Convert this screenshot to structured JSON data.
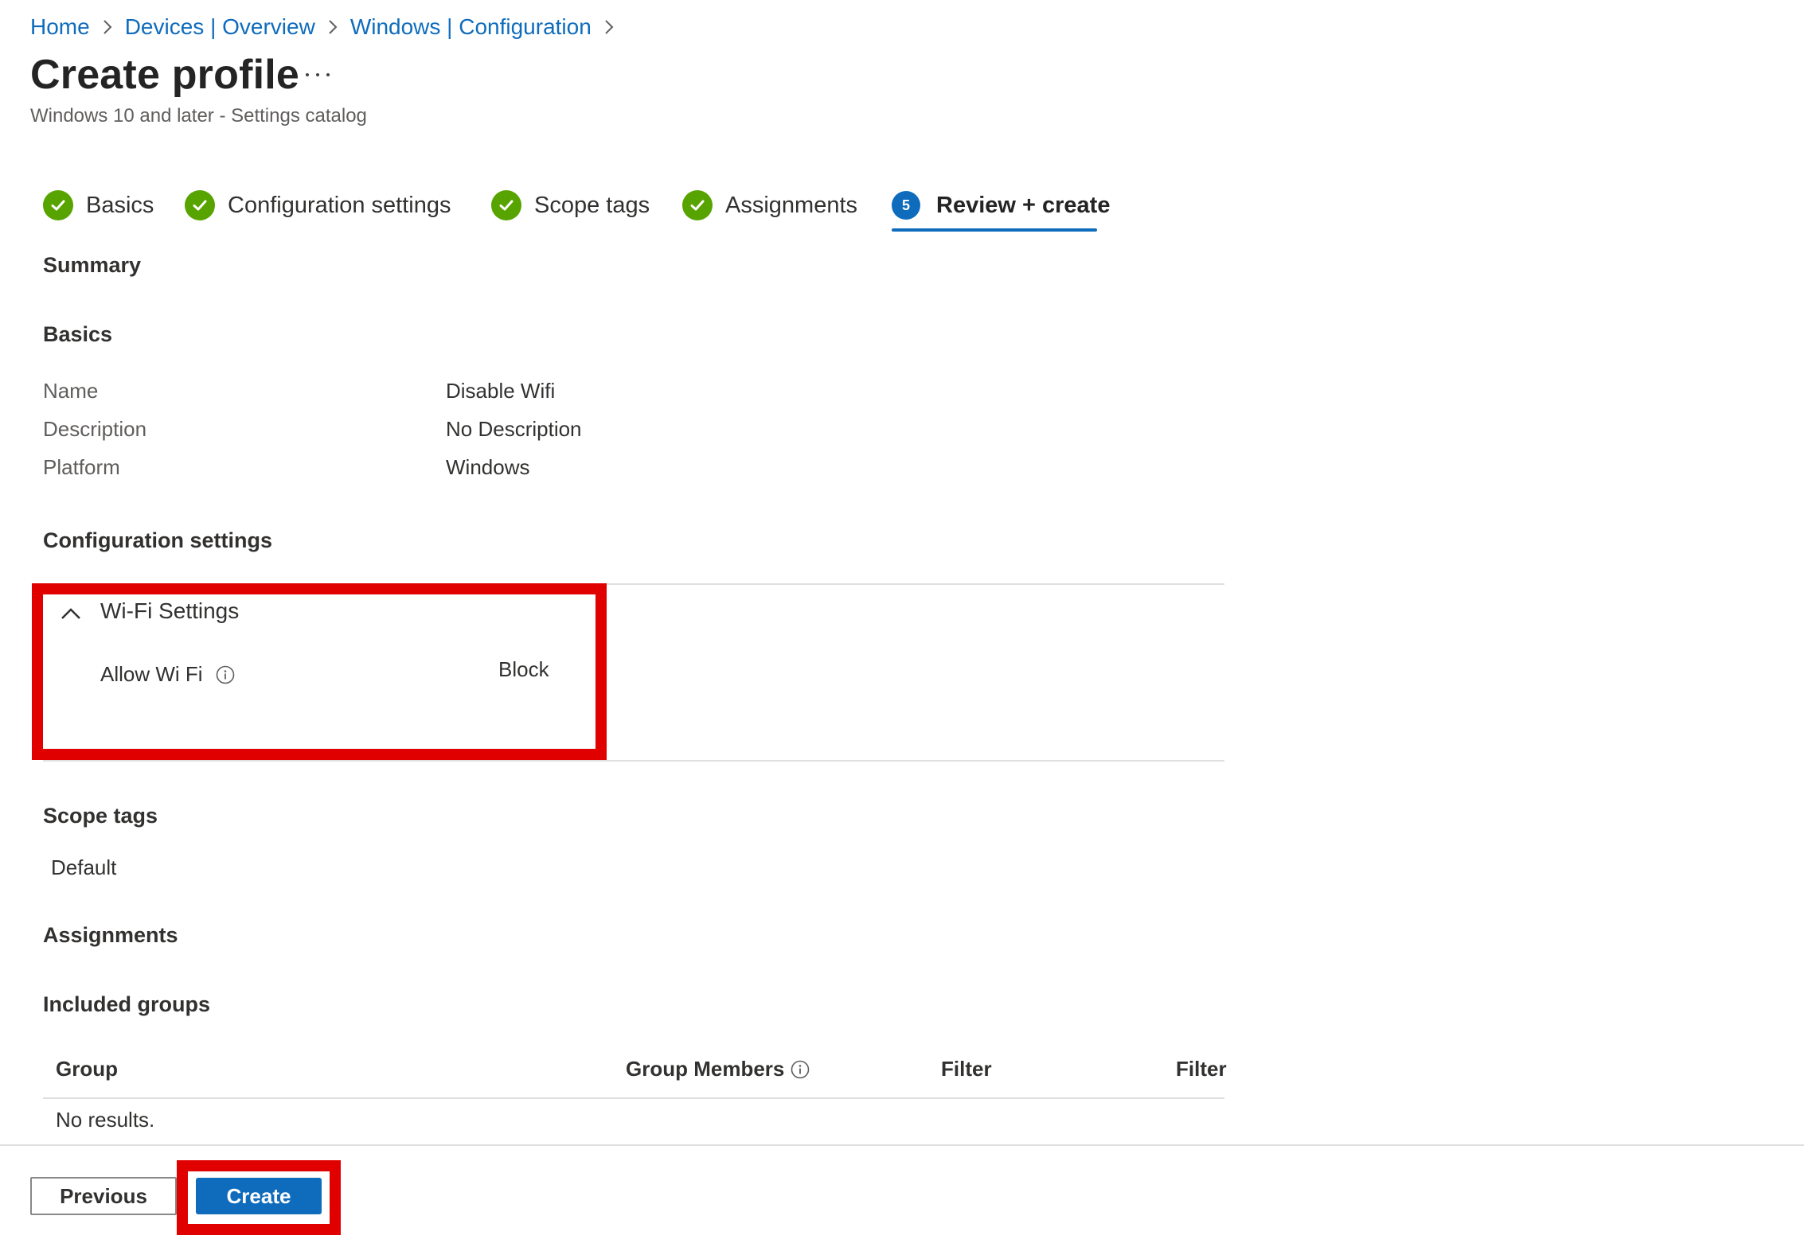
{
  "breadcrumb": {
    "items": [
      "Home",
      "Devices | Overview",
      "Windows | Configuration"
    ]
  },
  "header": {
    "title": "Create profile",
    "more_icon": "more-horizontal-icon",
    "subtitle": "Windows 10 and later - Settings catalog"
  },
  "steps": [
    {
      "label": "Basics",
      "status": "complete"
    },
    {
      "label": "Configuration settings",
      "status": "complete"
    },
    {
      "label": "Scope tags",
      "status": "complete"
    },
    {
      "label": "Assignments",
      "status": "complete"
    },
    {
      "label": "Review + create",
      "status": "active",
      "number": "5"
    }
  ],
  "summary": {
    "title": "Summary",
    "basics": {
      "title": "Basics",
      "rows": [
        {
          "label": "Name",
          "value": "Disable Wifi"
        },
        {
          "label": "Description",
          "value": "No Description"
        },
        {
          "label": "Platform",
          "value": "Windows"
        }
      ]
    },
    "configuration": {
      "title": "Configuration settings",
      "group_title": "Wi-Fi Settings",
      "setting_label": "Allow Wi Fi",
      "setting_value": "Block"
    },
    "scope_tags": {
      "title": "Scope tags",
      "value": "Default"
    },
    "assignments": {
      "title": "Assignments",
      "included_groups_title": "Included groups",
      "columns": [
        "Group",
        "Group Members",
        "Filter",
        "Filter"
      ],
      "empty_text": "No results."
    }
  },
  "footer": {
    "previous_label": "Previous",
    "create_label": "Create"
  },
  "colors": {
    "accent": "#0f6cbd",
    "success": "#57a300",
    "highlight": "#e00000"
  }
}
